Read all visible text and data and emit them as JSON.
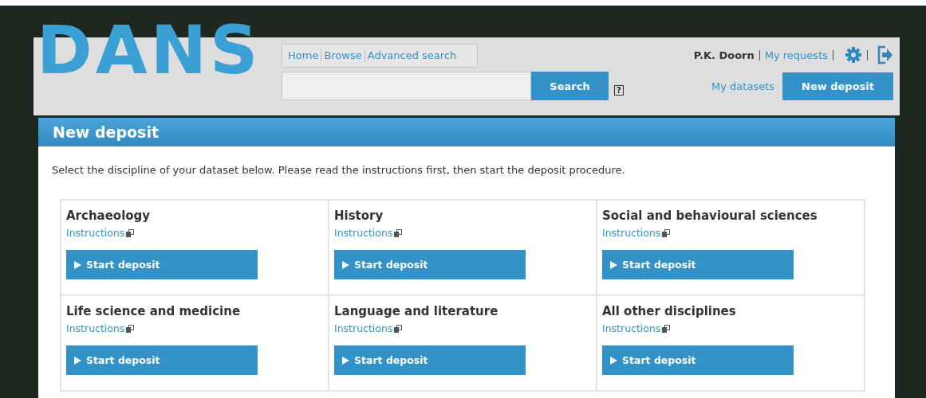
{
  "logo": "DANS",
  "nav": [
    {
      "label": "Home"
    },
    {
      "label": "Browse"
    },
    {
      "label": "Advanced search"
    }
  ],
  "search": {
    "button": "Search",
    "help": "?"
  },
  "user": {
    "name": "P.K. Doorn",
    "links": [
      "My requests"
    ]
  },
  "actions": {
    "link": "My datasets",
    "button": "New deposit"
  },
  "panel": {
    "title": "New deposit",
    "intro": "Select the discipline of your dataset below. Please read the instructions first, then start the deposit procedure."
  },
  "disciplines": [
    {
      "name": "Archaeology",
      "link": "Instructions",
      "button": "Start deposit"
    },
    {
      "name": "History",
      "link": "Instructions",
      "button": "Start deposit"
    },
    {
      "name": "Social and behavioural sciences",
      "link": "Instructions",
      "button": "Start deposit"
    },
    {
      "name": "Life science and medicine",
      "link": "Instructions",
      "button": "Start deposit"
    },
    {
      "name": "Language and literature",
      "link": "Instructions",
      "button": "Start deposit"
    },
    {
      "name": "All other disciplines",
      "link": "Instructions",
      "button": "Start deposit"
    }
  ]
}
